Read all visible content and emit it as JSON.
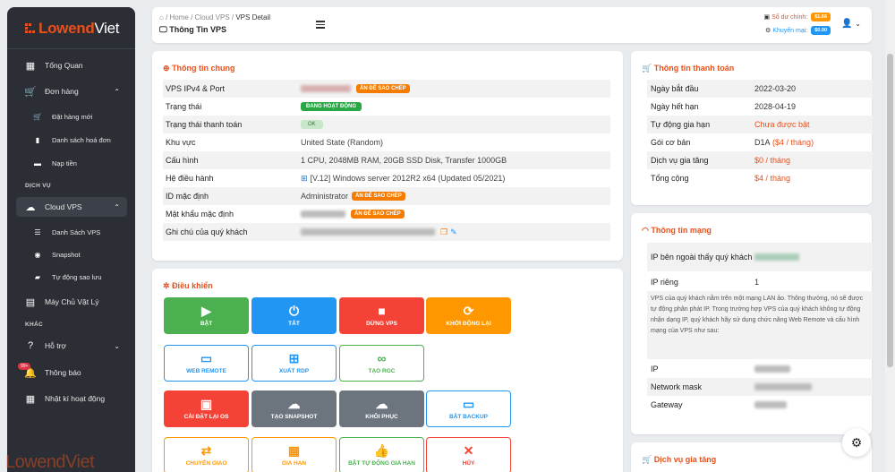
{
  "brand": {
    "name": "LowendViet",
    "prefix": "Lowend",
    "suffix": "Viet"
  },
  "sidebar": {
    "items": [
      {
        "label": "Tổng Quan",
        "icon": "dashboard-icon"
      },
      {
        "label": "Đơn hàng",
        "icon": "cart-icon"
      },
      {
        "label": "Đặt hàng mới",
        "icon": "cart-plus-icon"
      },
      {
        "label": "Danh sách hoá đơn",
        "icon": "file-icon"
      },
      {
        "label": "Nạp tiền",
        "icon": "wallet-icon"
      },
      {
        "label": "Cloud VPS",
        "icon": "cloud-icon"
      },
      {
        "label": "Danh Sách VPS",
        "icon": "list-icon"
      },
      {
        "label": "Snapshot",
        "icon": "camera-icon"
      },
      {
        "label": "Tự động sao lưu",
        "icon": "backup-icon"
      },
      {
        "label": "Máy Chủ Vật Lý",
        "icon": "server-icon"
      },
      {
        "label": "Hỗ trợ",
        "icon": "help-icon"
      },
      {
        "label": "Thông báo",
        "icon": "bell-icon"
      },
      {
        "label": "Nhật kí hoạt động",
        "icon": "calendar-icon"
      }
    ],
    "sections": [
      "DỊCH VỤ",
      "KHÁC"
    ],
    "notif_badge": "99+"
  },
  "topbar": {
    "breadcrumb": [
      "Home",
      "Cloud VPS",
      "VPS Detail"
    ],
    "title": "Thông Tin VPS",
    "balance_label": "Số dư chính:",
    "balance_value": "$1.66",
    "promo_label": "Khuyến mại:",
    "promo_value": "$0.00"
  },
  "general": {
    "title": "Thông tin chung",
    "copy_label": "ẤN ĐỂ SAO CHÉP",
    "rows": [
      {
        "key": "VPS IPv4 & Port"
      },
      {
        "key": "Trạng thái",
        "value": "ĐANG HOẠT ĐỘNG"
      },
      {
        "key": "Trạng thái thanh toán",
        "value": "OK"
      },
      {
        "key": "Khu vực",
        "value": "United State (Random)"
      },
      {
        "key": "Cấu hình",
        "value": "1 CPU, 2048MB RAM, 20GB SSD Disk, Transfer 1000GB"
      },
      {
        "key": "Hệ điều hành",
        "value": "[V.12] Windows server 2012R2 x64 (Updated 05/2021)"
      },
      {
        "key": "ID mặc định",
        "value": "Administrator"
      },
      {
        "key": "Mật khẩu mặc định"
      },
      {
        "key": "Ghi chú của quý khách"
      }
    ]
  },
  "controls": {
    "title": "Điều khiển",
    "buttons": [
      {
        "label": "BẬT",
        "icon": "play-icon",
        "color": "#4caf50",
        "style": "solid"
      },
      {
        "label": "TẮT",
        "icon": "power-icon",
        "color": "#2196f3",
        "style": "solid"
      },
      {
        "label": "DỪNG VPS",
        "icon": "stop-icon",
        "color": "#f44336",
        "style": "solid"
      },
      {
        "label": "KHỞI ĐỘNG LẠI",
        "icon": "refresh-icon",
        "color": "#ff9800",
        "style": "solid"
      },
      {
        "label": "WEB REMOTE",
        "icon": "vnc-icon",
        "color": "#2196f3",
        "style": "outline"
      },
      {
        "label": "XUẤT RDP",
        "icon": "windows-icon",
        "color": "#2196f3",
        "style": "outline"
      },
      {
        "label": "TẠO RGC",
        "icon": "link-icon",
        "color": "#4caf50",
        "style": "outline"
      },
      {
        "label": "CÀI ĐẶT LẠI OS",
        "icon": "floppy-icon",
        "color": "#f44336",
        "style": "solid"
      },
      {
        "label": "TẠO SNAPSHOT",
        "icon": "cloud-upload-icon",
        "color": "#6c757d",
        "style": "solid"
      },
      {
        "label": "KHÔI PHỤC",
        "icon": "cloud-download-icon",
        "color": "#6c757d",
        "style": "solid"
      },
      {
        "label": "BẬT BACKUP",
        "icon": "hdd-icon",
        "color": "#2196f3",
        "style": "outline"
      },
      {
        "label": "CHUYỂN GIAO",
        "icon": "exchange-icon",
        "color": "#ff9800",
        "style": "outline"
      },
      {
        "label": "GIA HẠN",
        "icon": "calendar-icon",
        "color": "#ff9800",
        "style": "outline"
      },
      {
        "label": "BẬT TỰ ĐỘNG GIA HẠN",
        "icon": "thumbs-up-icon",
        "color": "#4caf50",
        "style": "outline"
      },
      {
        "label": "HỦY",
        "icon": "x-icon",
        "color": "#f44336",
        "style": "outline"
      }
    ]
  },
  "payment": {
    "title": "Thông tin thanh toán",
    "rows": [
      {
        "key": "Ngày bắt đầu",
        "value": "2022-03-20"
      },
      {
        "key": "Ngày hết hạn",
        "value": "2028-04-19"
      },
      {
        "key": "Tự động gia hạn",
        "value": "Chưa được bật"
      },
      {
        "key": "Gói cơ bản",
        "value": "D1A",
        "extra": "($4 / tháng)"
      },
      {
        "key": "Dịch vụ gia tăng",
        "value": "$0 / tháng"
      },
      {
        "key": "Tổng cộng",
        "value": "$4 / tháng"
      }
    ]
  },
  "network": {
    "title": "Thông tin mạng",
    "public_ip_label": "IP bên ngoài thấy quý khách",
    "private_ip_label": "IP riêng",
    "private_ip_value": "1",
    "note": "VPS của quý khách nằm trên một mạng LAN ảo. Thông thường, nó sẽ được tự động phân phát IP. Trong trường hợp VPS của quý khách không tự động nhận dạng IP, quý khách hãy sử dụng chức năng Web Remote và cấu hình mạng của VPS như sau:",
    "ip_label": "IP",
    "mask_label": "Network mask",
    "gateway_label": "Gateway"
  },
  "addons": {
    "title": "Dịch vụ gia tăng"
  },
  "colors": {
    "accent": "#e8501c",
    "sidebar": "#2b2e35",
    "copy": "#f57c00",
    "balance": "#ff9800",
    "promo": "#2196f3"
  }
}
